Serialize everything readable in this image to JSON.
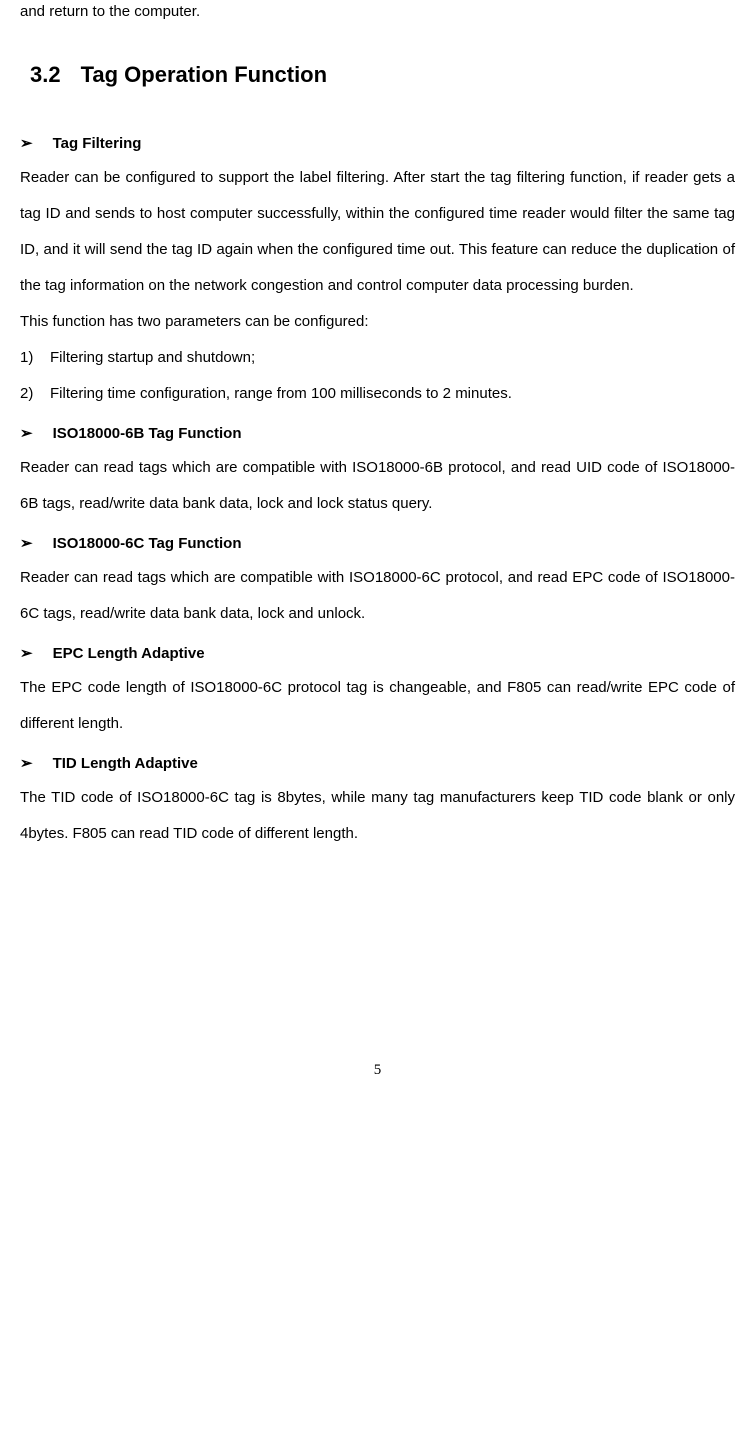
{
  "continuation": "and return to the computer.",
  "section": {
    "number": "3.2",
    "title": "Tag Operation Function"
  },
  "subsections": [
    {
      "bullet": "➢",
      "title": "Tag Filtering",
      "paragraphs": [
        "Reader can be configured to support the label filtering. After start the tag filtering function, if reader gets a tag ID and sends to host computer successfully, within the configured time reader would filter the same tag ID, and it will send the tag ID again when the configured time out. This feature can reduce the duplication of the tag information on the network congestion and control computer data processing burden.",
        "This function has two parameters can be configured:"
      ],
      "numbered": [
        {
          "num": "1)",
          "text": "Filtering startup and shutdown;"
        },
        {
          "num": "2)",
          "text": "Filtering time configuration, range from 100 milliseconds to 2 minutes."
        }
      ]
    },
    {
      "bullet": "➢",
      "title": "ISO18000-6B Tag Function",
      "paragraphs": [
        "Reader can read tags which are compatible with ISO18000-6B protocol, and read UID code of ISO18000-6B tags, read/write data bank data, lock and lock status query."
      ]
    },
    {
      "bullet": "➢",
      "title": "ISO18000-6C Tag Function",
      "paragraphs": [
        "Reader can read tags which are compatible with ISO18000-6C protocol, and read EPC code of ISO18000-6C tags, read/write data bank data, lock and unlock."
      ]
    },
    {
      "bullet": "➢",
      "title": "EPC Length Adaptive",
      "paragraphs": [
        "The EPC code length of ISO18000-6C protocol tag is changeable, and F805 can read/write EPC code of different length."
      ]
    },
    {
      "bullet": "➢",
      "title": "TID Length Adaptive",
      "paragraphs": [
        "The TID code of ISO18000-6C tag is 8bytes, while many tag manufacturers keep TID code blank or only 4bytes. F805 can read TID code of different length."
      ]
    }
  ],
  "pageNumber": "5"
}
